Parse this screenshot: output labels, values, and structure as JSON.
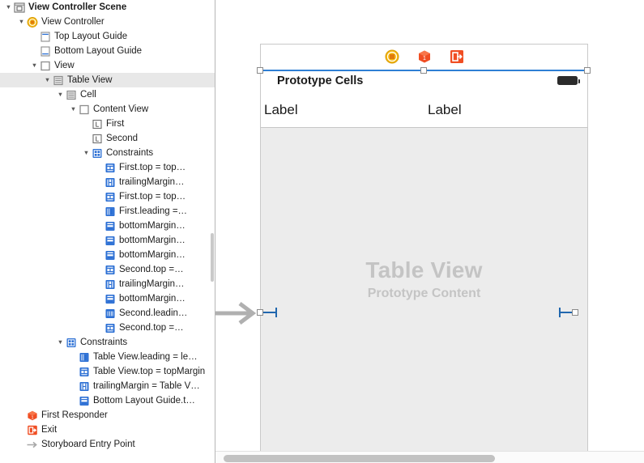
{
  "outline": {
    "rows": [
      {
        "indent": 0,
        "twisty": "down",
        "icon": "scene-icon",
        "label": "View Controller Scene",
        "bold": true,
        "stripe": false
      },
      {
        "indent": 1,
        "twisty": "down",
        "icon": "view-controller-icon",
        "label": "View Controller",
        "bold": false,
        "stripe": false
      },
      {
        "indent": 2,
        "twisty": "none",
        "icon": "top-layout-guide-icon",
        "label": "Top Layout Guide",
        "bold": false,
        "stripe": false
      },
      {
        "indent": 2,
        "twisty": "none",
        "icon": "bottom-layout-guide-icon",
        "label": "Bottom Layout Guide",
        "bold": false,
        "stripe": false
      },
      {
        "indent": 2,
        "twisty": "down",
        "icon": "view-icon",
        "label": "View",
        "bold": false,
        "stripe": false
      },
      {
        "indent": 3,
        "twisty": "down",
        "icon": "table-view-icon",
        "label": "Table View",
        "bold": false,
        "stripe": true
      },
      {
        "indent": 4,
        "twisty": "down",
        "icon": "table-cell-icon",
        "label": "Cell",
        "bold": false,
        "stripe": false
      },
      {
        "indent": 5,
        "twisty": "down",
        "icon": "content-view-icon",
        "label": "Content View",
        "bold": false,
        "stripe": false
      },
      {
        "indent": 6,
        "twisty": "none",
        "icon": "label-icon",
        "label": "First",
        "bold": false,
        "stripe": false
      },
      {
        "indent": 6,
        "twisty": "none",
        "icon": "label-icon",
        "label": "Second",
        "bold": false,
        "stripe": false
      },
      {
        "indent": 6,
        "twisty": "down",
        "icon": "constraints-folder-icon",
        "label": "Constraints",
        "bold": false,
        "stripe": false
      },
      {
        "indent": 7,
        "twisty": "none",
        "icon": "constraint-vertical-icon",
        "label": "First.top = top…",
        "bold": false,
        "stripe": false
      },
      {
        "indent": 7,
        "twisty": "none",
        "icon": "constraint-horizontal-icon",
        "label": "trailingMargin…",
        "bold": false,
        "stripe": false
      },
      {
        "indent": 7,
        "twisty": "none",
        "icon": "constraint-vertical-icon",
        "label": "First.top = top…",
        "bold": false,
        "stripe": false
      },
      {
        "indent": 7,
        "twisty": "none",
        "icon": "constraint-leading-icon",
        "label": "First.leading =…",
        "bold": false,
        "stripe": false
      },
      {
        "indent": 7,
        "twisty": "none",
        "icon": "constraint-bottom-icon",
        "label": "bottomMargin…",
        "bold": false,
        "stripe": false
      },
      {
        "indent": 7,
        "twisty": "none",
        "icon": "constraint-bottom-icon",
        "label": "bottomMargin…",
        "bold": false,
        "stripe": false
      },
      {
        "indent": 7,
        "twisty": "none",
        "icon": "constraint-bottom-icon",
        "label": "bottomMargin…",
        "bold": false,
        "stripe": false
      },
      {
        "indent": 7,
        "twisty": "none",
        "icon": "constraint-vertical-icon",
        "label": "Second.top =…",
        "bold": false,
        "stripe": false
      },
      {
        "indent": 7,
        "twisty": "none",
        "icon": "constraint-horizontal-icon",
        "label": "trailingMargin…",
        "bold": false,
        "stripe": false
      },
      {
        "indent": 7,
        "twisty": "none",
        "icon": "constraint-bottom-icon",
        "label": "bottomMargin…",
        "bold": false,
        "stripe": false
      },
      {
        "indent": 7,
        "twisty": "none",
        "icon": "constraint-width-icon",
        "label": "Second.leadin…",
        "bold": false,
        "stripe": false
      },
      {
        "indent": 7,
        "twisty": "none",
        "icon": "constraint-vertical-icon",
        "label": "Second.top =…",
        "bold": false,
        "stripe": false
      },
      {
        "indent": 4,
        "twisty": "down",
        "icon": "constraints-folder-icon",
        "label": "Constraints",
        "bold": false,
        "stripe": false
      },
      {
        "indent": 5,
        "twisty": "none",
        "icon": "constraint-leading-icon",
        "label": "Table View.leading = le…",
        "bold": false,
        "stripe": false
      },
      {
        "indent": 5,
        "twisty": "none",
        "icon": "constraint-vertical-icon",
        "label": "Table View.top = topMargin",
        "bold": false,
        "stripe": false
      },
      {
        "indent": 5,
        "twisty": "none",
        "icon": "constraint-horizontal-icon",
        "label": "trailingMargin = Table V…",
        "bold": false,
        "stripe": false
      },
      {
        "indent": 5,
        "twisty": "none",
        "icon": "constraint-bottom-icon",
        "label": "Bottom Layout Guide.t…",
        "bold": false,
        "stripe": false
      },
      {
        "indent": 1,
        "twisty": "none",
        "icon": "first-responder-icon",
        "label": "First Responder",
        "bold": false,
        "stripe": false
      },
      {
        "indent": 1,
        "twisty": "none",
        "icon": "exit-icon",
        "label": "Exit",
        "bold": false,
        "stripe": false
      },
      {
        "indent": 1,
        "twisty": "none",
        "icon": "entry-arrow-icon",
        "label": "Storyboard Entry Point",
        "bold": false,
        "stripe": false
      }
    ]
  },
  "canvas": {
    "dock": [
      {
        "name": "view-controller-dock-icon",
        "title": "View Controller"
      },
      {
        "name": "first-responder-dock-icon",
        "title": "First Responder"
      },
      {
        "name": "exit-dock-icon",
        "title": "Exit"
      }
    ],
    "prototype_cells_label": "Prototype Cells",
    "cell_label_left": "Label",
    "cell_label_right": "Label",
    "placeholder_title": "Table View",
    "placeholder_subtitle": "Prototype Content"
  },
  "colors": {
    "selection_blue": "#2e7fd4",
    "constraint_blue": "#2167ae",
    "constraint_icon_blue": "#2b6fd4",
    "view_controller_yellow": "#f5b812",
    "exit_orange": "#f04e23",
    "placeholder_gray": "#c4c4c4",
    "table_body_gray": "#ececec",
    "row_stripe": "#e8e8e8"
  }
}
